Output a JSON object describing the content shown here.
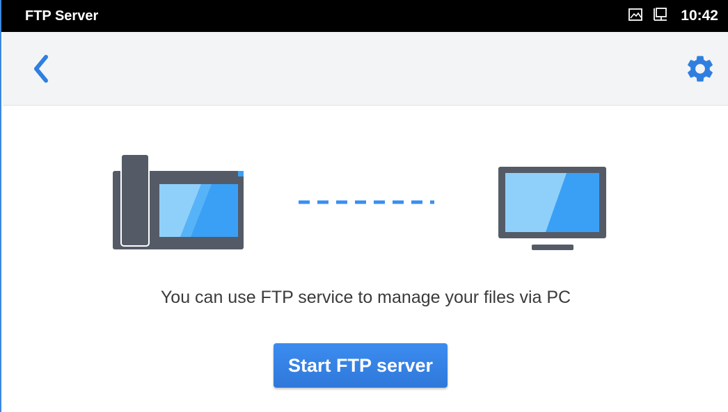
{
  "status_bar": {
    "title": "FTP Server",
    "time": "10:42",
    "icons": [
      "picture-icon",
      "ethernet-icon"
    ]
  },
  "toolbar": {
    "back_icon": "chevron-left-icon",
    "settings_icon": "gear-icon"
  },
  "main": {
    "message": "You can use FTP service to manage your files via PC",
    "start_button_label": "Start FTP server"
  },
  "colors": {
    "accent": "#2f7fe0",
    "status_bar_bg": "#000000",
    "toolbar_bg": "#f3f4f5",
    "device_gray": "#555b66",
    "screen_blue": "#3aa0f5"
  }
}
